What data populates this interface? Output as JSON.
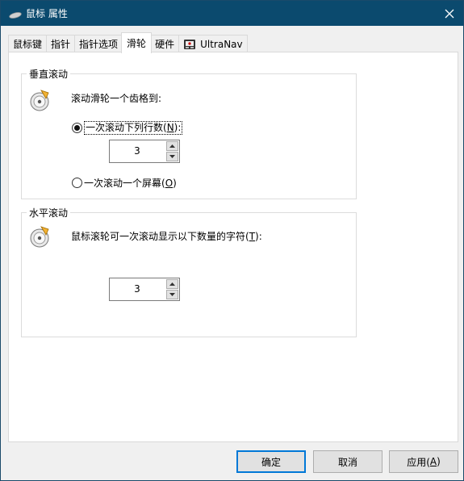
{
  "window": {
    "title": "鼠标 属性",
    "app_icon": "mouse-icon",
    "close_icon": "close-icon",
    "titlebar_color": "#0b4a6e"
  },
  "tabs": [
    {
      "label": "鼠标键"
    },
    {
      "label": "指针"
    },
    {
      "label": "指针选项"
    },
    {
      "label": "滑轮",
      "active": true
    },
    {
      "label": "硬件"
    },
    {
      "label": "UltraNav",
      "icon": "ultranav-icon"
    }
  ],
  "vertical": {
    "group_title": "垂直滚动",
    "description": "滚动滑轮一个齿格到:",
    "option_lines": {
      "pre": "一次滚动下列行数(",
      "key": "N",
      "post": "):",
      "selected": true
    },
    "lines_value": "3",
    "option_screen": {
      "pre": "一次滚动一个屏幕(",
      "key": "O",
      "post": ")",
      "selected": false
    }
  },
  "horizontal": {
    "group_title": "水平滚动",
    "description_pre": "鼠标滚轮可一次滚动显示以下数量的字符(",
    "description_key": "T",
    "description_post": "):",
    "chars_value": "3"
  },
  "buttons": {
    "ok": "确定",
    "cancel": "取消",
    "apply_pre": "应用(",
    "apply_key": "A",
    "apply_post": ")"
  }
}
